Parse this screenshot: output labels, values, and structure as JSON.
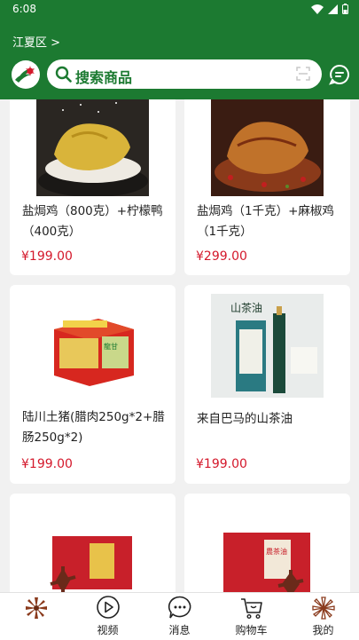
{
  "status": {
    "time": "6:08"
  },
  "header": {
    "location": "江夏区 >",
    "search_placeholder": "搜索商品"
  },
  "products": [
    {
      "name": "盐焗鸡（800克）+柠檬鸭（400克）",
      "price": "¥199.00"
    },
    {
      "name": "盐焗鸡（1千克）+麻椒鸡（1千克）",
      "price": "¥299.00"
    },
    {
      "name": "陆川土猪(腊肉250g*2+腊肠250g*2)",
      "price": "¥199.00"
    },
    {
      "name": "来自巴马的山茶油",
      "price": "¥199.00"
    },
    {
      "name": "",
      "price": ""
    },
    {
      "name": "",
      "price": ""
    }
  ],
  "product_images": {
    "oil_brand": "山茶油",
    "box_sign_1": "龍甘",
    "box_sign_2": "農茶油"
  },
  "tabbar": {
    "items": [
      {
        "label": "",
        "icon": "star-anise-icon"
      },
      {
        "label": "视频",
        "icon": "play-icon"
      },
      {
        "label": "消息",
        "icon": "chat-icon"
      },
      {
        "label": "购物车",
        "icon": "cart-icon"
      },
      {
        "label": "我的",
        "icon": "star-anise-outline-icon"
      }
    ]
  },
  "colors": {
    "brand_green": "#1c7a31",
    "price_red": "#d4182b",
    "background": "#f1f1f1"
  }
}
